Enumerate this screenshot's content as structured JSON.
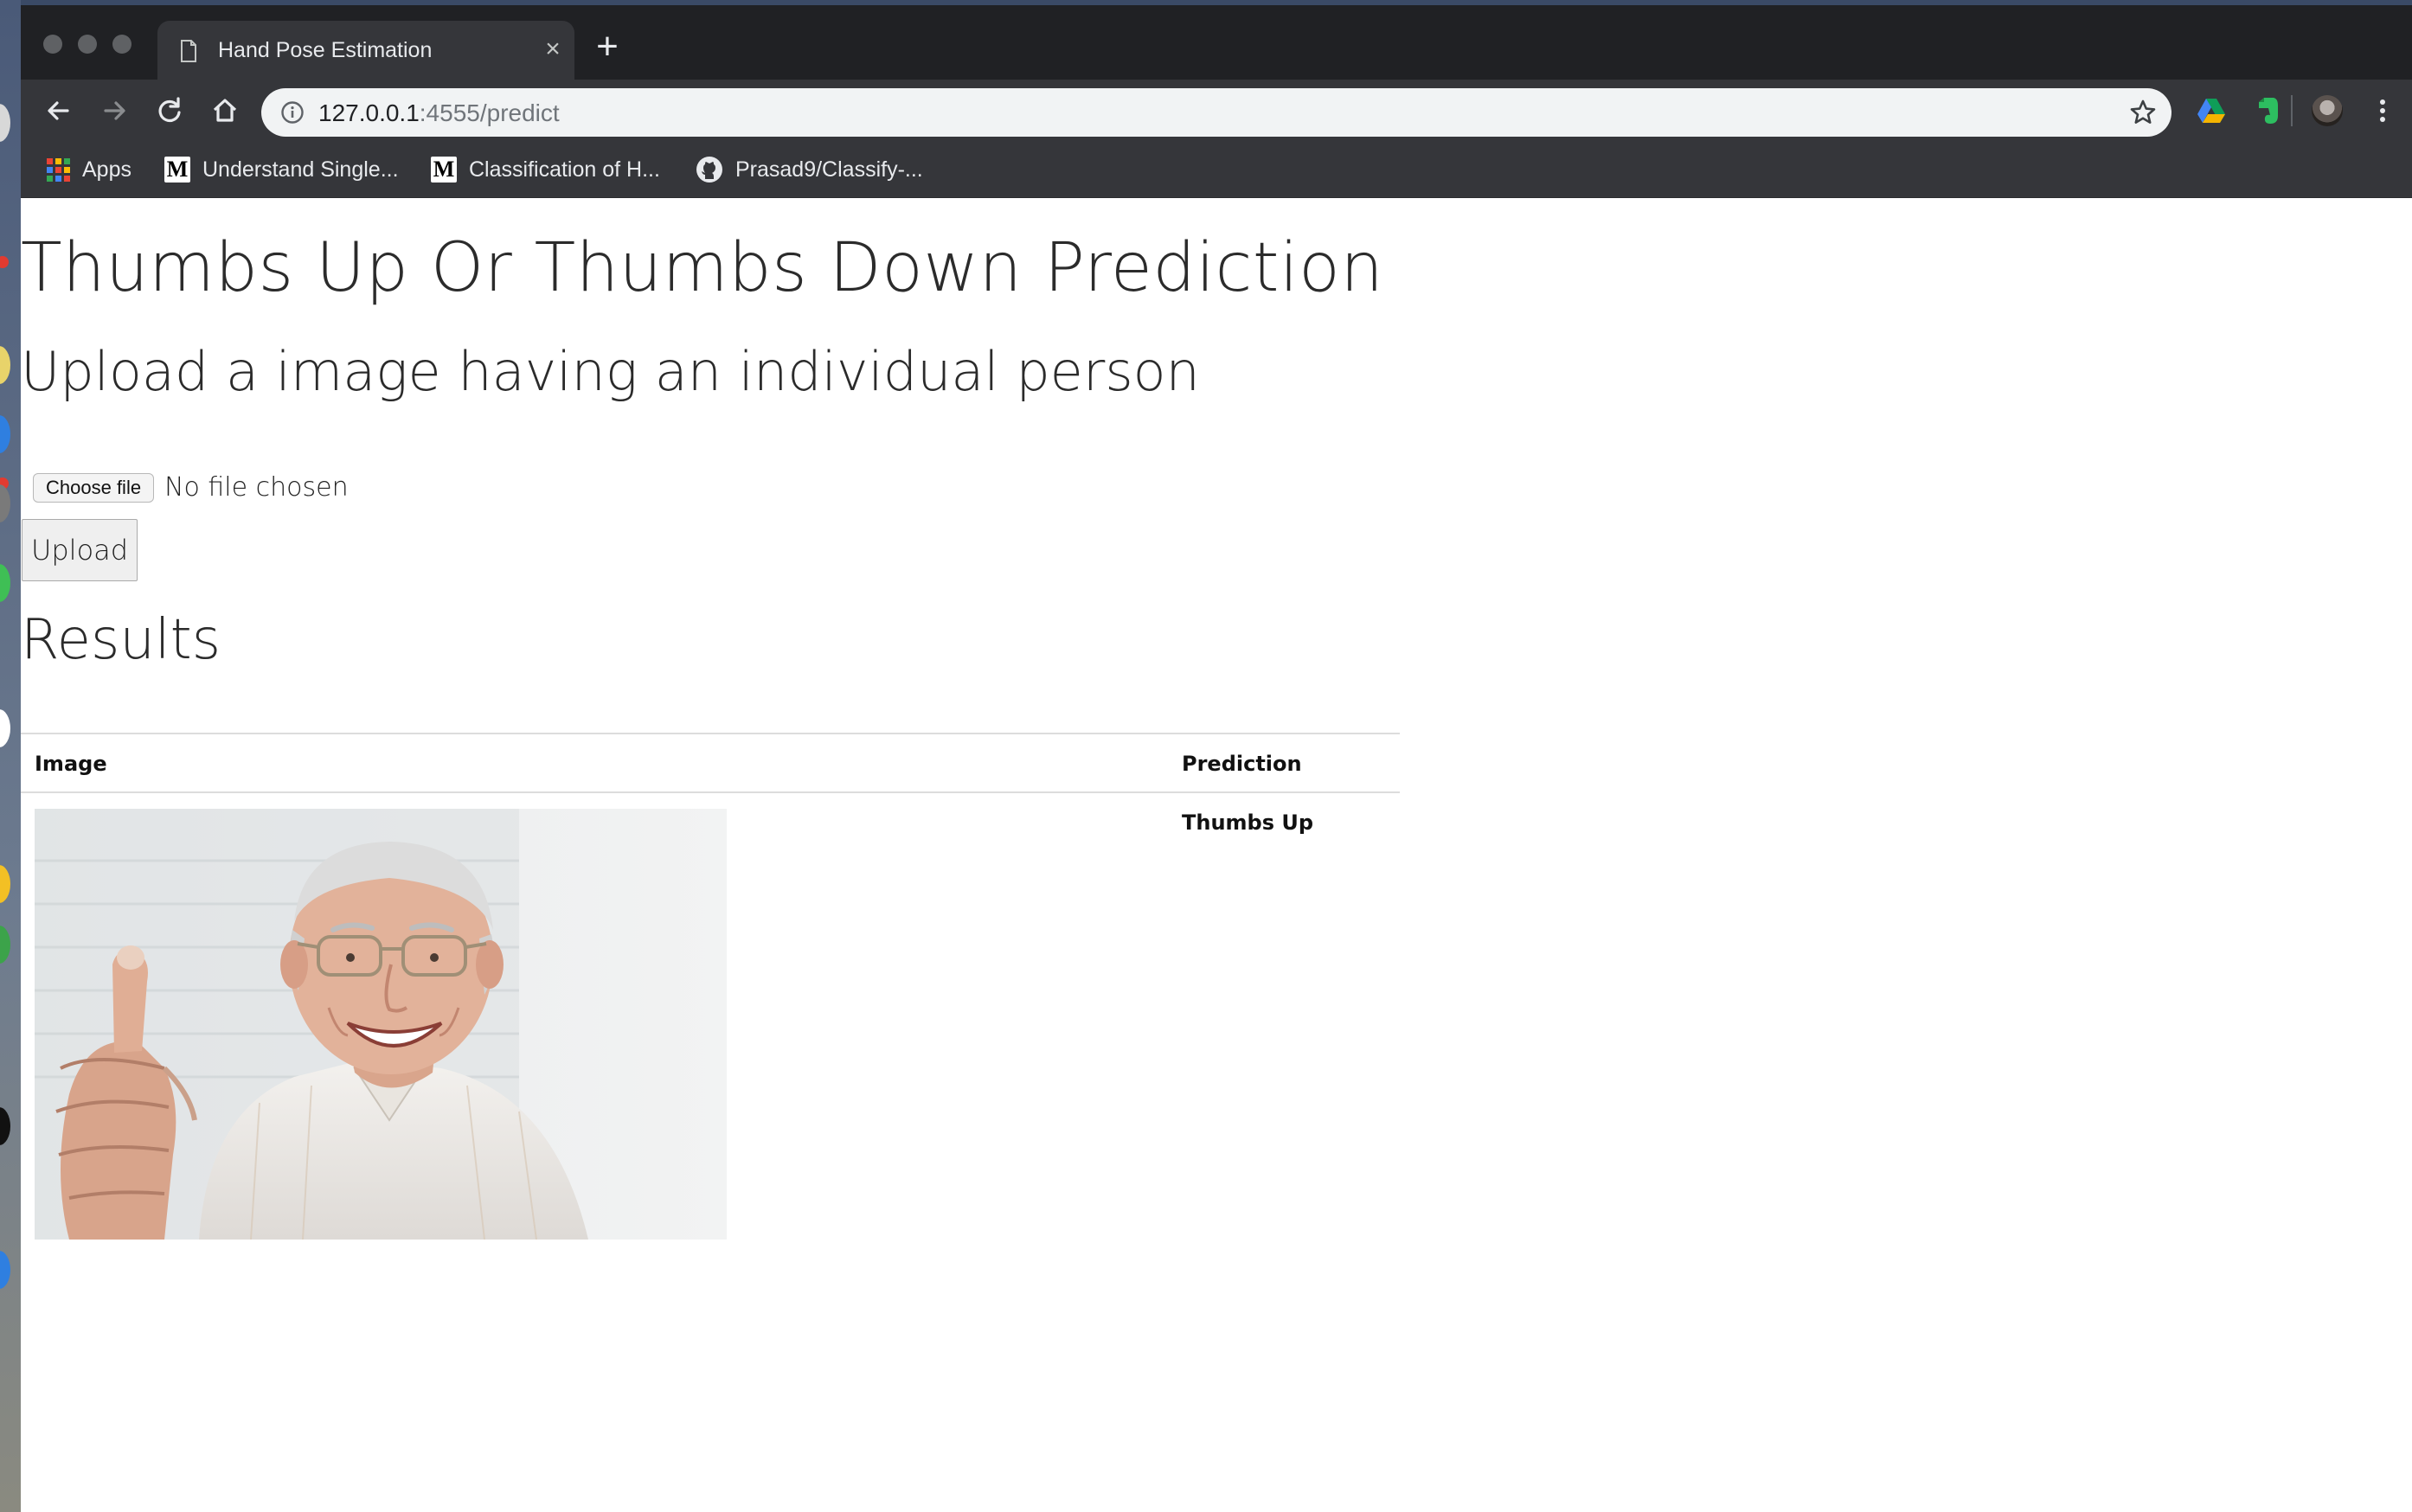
{
  "browser": {
    "tab": {
      "title": "Hand Pose Estimation"
    },
    "address_bar": {
      "host": "127.0.0.1",
      "rest": ":4555/predict"
    },
    "bookmarks": [
      {
        "label": "Apps",
        "icon": "apps-grid-icon"
      },
      {
        "label": "Understand Single...",
        "icon": "medium-icon"
      },
      {
        "label": "Classification of H...",
        "icon": "medium-icon"
      },
      {
        "label": "Prasad9/Classify-...",
        "icon": "github-icon"
      }
    ]
  },
  "page": {
    "title": "Thumbs Up Or Thumbs Down Prediction",
    "subtitle": "Upload a image having an individual person",
    "file_input": {
      "button_label": "Choose file",
      "status": "No file chosen"
    },
    "upload_button": "Upload",
    "results_heading": "Results",
    "table": {
      "headers": {
        "image": "Image",
        "prediction": "Prediction"
      },
      "rows": [
        {
          "prediction": "Thumbs Up",
          "image_alt": "elderly man giving thumbs up"
        }
      ]
    }
  },
  "colors": {
    "chrome_dark": "#202124",
    "chrome_toolbar": "#35363a",
    "omnibox": "#f1f3f4",
    "page_text": "#2b2b2b"
  }
}
